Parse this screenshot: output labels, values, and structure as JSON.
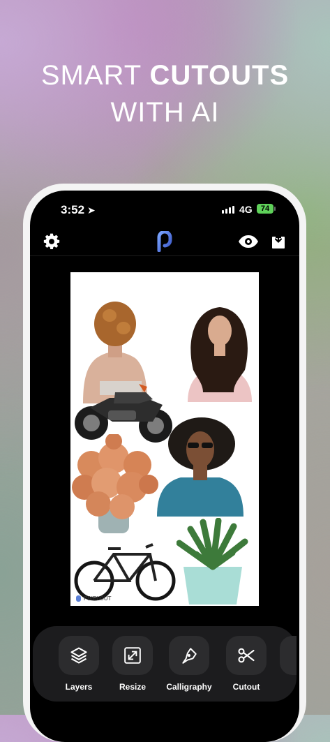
{
  "headline": {
    "line1_a": "SMART ",
    "line1_b": "CUTOUTS",
    "line2": "WITH AI"
  },
  "status_bar": {
    "time": "3:52",
    "network": "4G",
    "battery": "74"
  },
  "app": {
    "logo_icon": "pixelout-logo-icon",
    "watermark": "PIXELOUT"
  },
  "toolbar": {
    "tools": [
      {
        "label": "Layers",
        "icon": "layers-icon"
      },
      {
        "label": "Resize",
        "icon": "resize-icon"
      },
      {
        "label": "Calligraphy",
        "icon": "pen-nib-icon"
      },
      {
        "label": "Cutout",
        "icon": "scissors-icon"
      }
    ]
  },
  "colors": {
    "screen_bg": "#000000",
    "toolbar_bg": "#1c1c1e",
    "button_bg": "#2c2c2e",
    "battery": "#5fd15a",
    "logo": "#5a7fd6"
  }
}
